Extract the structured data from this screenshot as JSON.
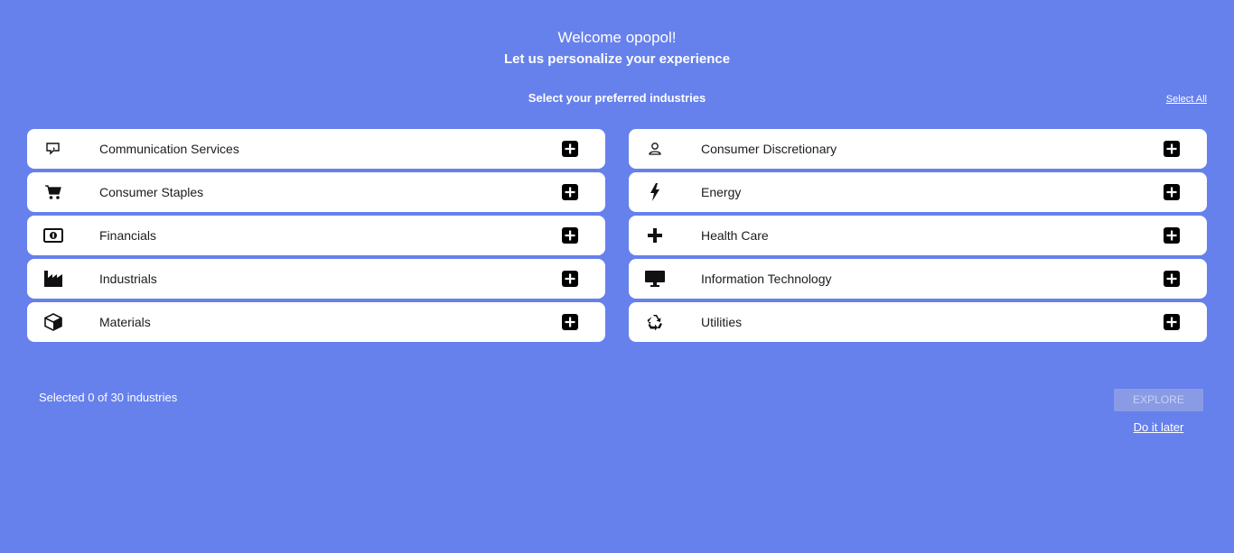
{
  "header": {
    "welcome": "Welcome opopol!",
    "subtitle": "Let us personalize your experience",
    "prompt": "Select your preferred industries",
    "select_all": "Select All"
  },
  "industries": [
    {
      "label": "Communication Services",
      "icon": "chat-bubble-icon"
    },
    {
      "label": "Consumer Discretionary",
      "icon": "user-icon"
    },
    {
      "label": "Consumer Staples",
      "icon": "shopping-cart-icon"
    },
    {
      "label": "Energy",
      "icon": "lightning-bolt-icon"
    },
    {
      "label": "Financials",
      "icon": "money-bill-icon"
    },
    {
      "label": "Health Care",
      "icon": "medical-cross-icon"
    },
    {
      "label": "Industrials",
      "icon": "factory-icon"
    },
    {
      "label": "Information Technology",
      "icon": "monitor-icon"
    },
    {
      "label": "Materials",
      "icon": "cube-icon"
    },
    {
      "label": "Utilities",
      "icon": "recycle-icon"
    }
  ],
  "footer": {
    "selected_text": "Selected 0 of 30 industries",
    "explore": "EXPLORE",
    "later": "Do it later"
  },
  "colors": {
    "background": "#6680ec",
    "card": "#ffffff",
    "explore_disabled": "#8a9be6"
  }
}
